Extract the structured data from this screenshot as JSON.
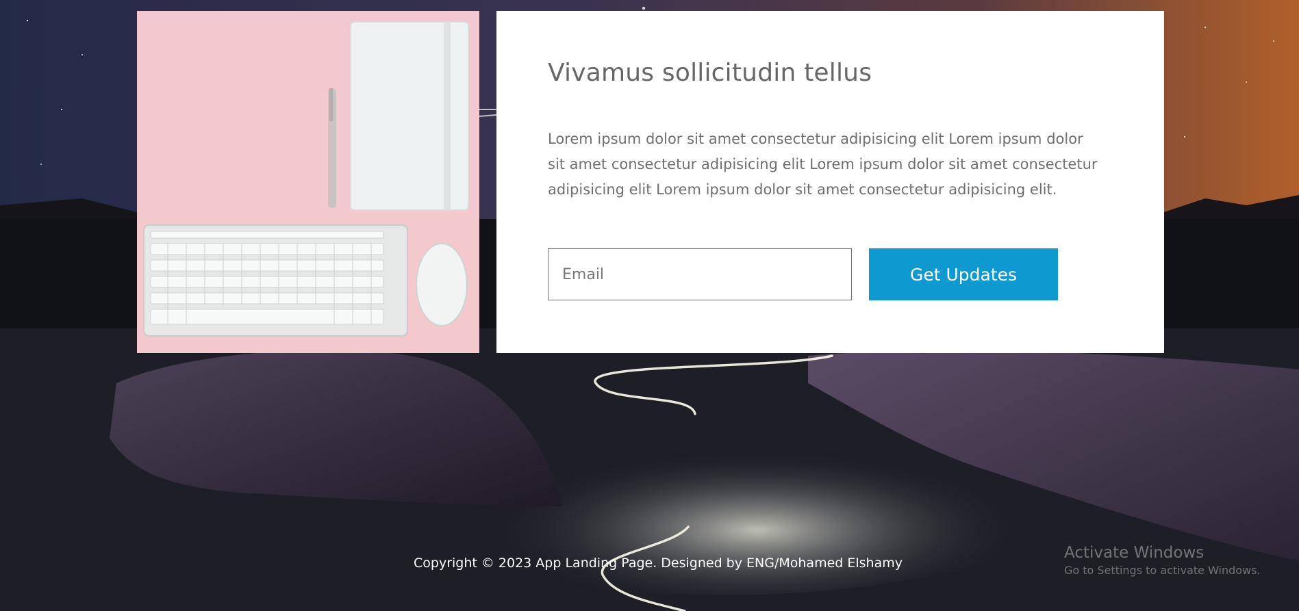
{
  "card": {
    "title": "Vivamus sollicitudin tellus",
    "text": "Lorem ipsum dolor sit amet consectetur adipisicing elit Lorem ipsum dolor sit amet consectetur adipisicing elit Lorem ipsum dolor sit amet consectetur adipisicing elit Lorem ipsum dolor sit amet consectetur adipisicing elit.",
    "email_placeholder": "Email",
    "email_value": "",
    "button_label": "Get Updates"
  },
  "footer": {
    "copyright": "Copyright © 2023 App Landing Page. Designed by ENG/Mohamed Elshamy"
  },
  "watermark": {
    "title": "Activate Windows",
    "subtitle": "Go to Settings to activate Windows."
  },
  "colors": {
    "accent": "#0e9ad1",
    "photo_background": "#f3c9cd",
    "card_background": "#ffffff",
    "text": "#6f6f6f"
  },
  "icons": {
    "photo": "desk-flatlay-keyboard-mouse-notebook-pen",
    "background": "night-landscape-river-light-trail"
  }
}
